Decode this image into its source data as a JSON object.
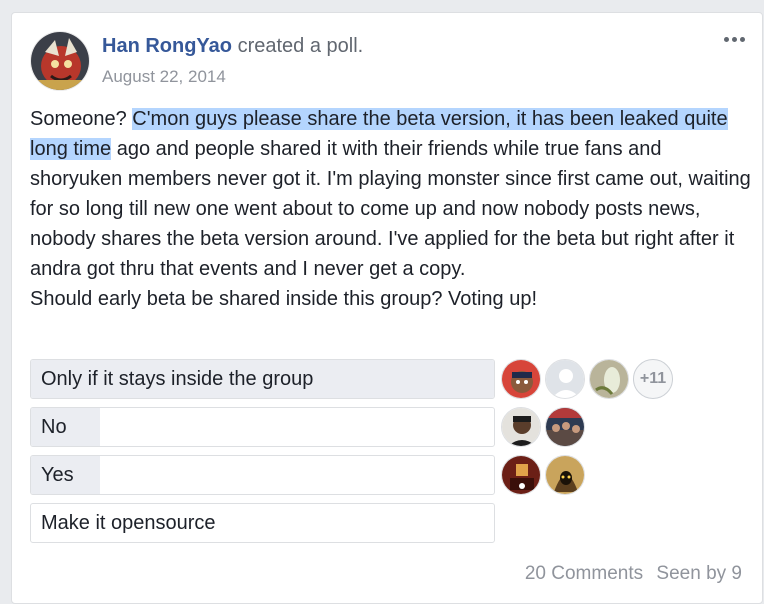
{
  "post": {
    "author_name": "Han RongYao",
    "action_text": "created a poll.",
    "date": "August 22, 2014",
    "text_before_highlight": "Someone? ",
    "text_highlight": "C'mon guys please share the beta version, it has been leaked quite long time",
    "text_after_highlight": " ago and people shared it with their friends while true fans and shoryuken members never got it. I'm playing monster since first came out, waiting for so long till new one went about to come up and now nobody posts news, nobody shares the beta version around. I've applied for the beta but right after it andra got thru that events and I never get a copy.",
    "question": "Should early beta be shared inside this group? Voting up!"
  },
  "poll": {
    "options": [
      {
        "label": "Only if it stays inside the group",
        "fill_fraction": 1.0
      },
      {
        "label": "No",
        "fill_fraction": 0.15
      },
      {
        "label": "Yes",
        "fill_fraction": 0.15
      },
      {
        "label": "Make it opensource",
        "fill_fraction": 0.0
      }
    ],
    "more_voters_label": "+11"
  },
  "footer": {
    "comments": "20 Comments",
    "seen_by": "Seen by 9"
  },
  "colors": {
    "author_link": "#365899",
    "highlight": "#b4d5fe",
    "poll_fill": "#ebedf2",
    "meta_text": "#90949c"
  }
}
